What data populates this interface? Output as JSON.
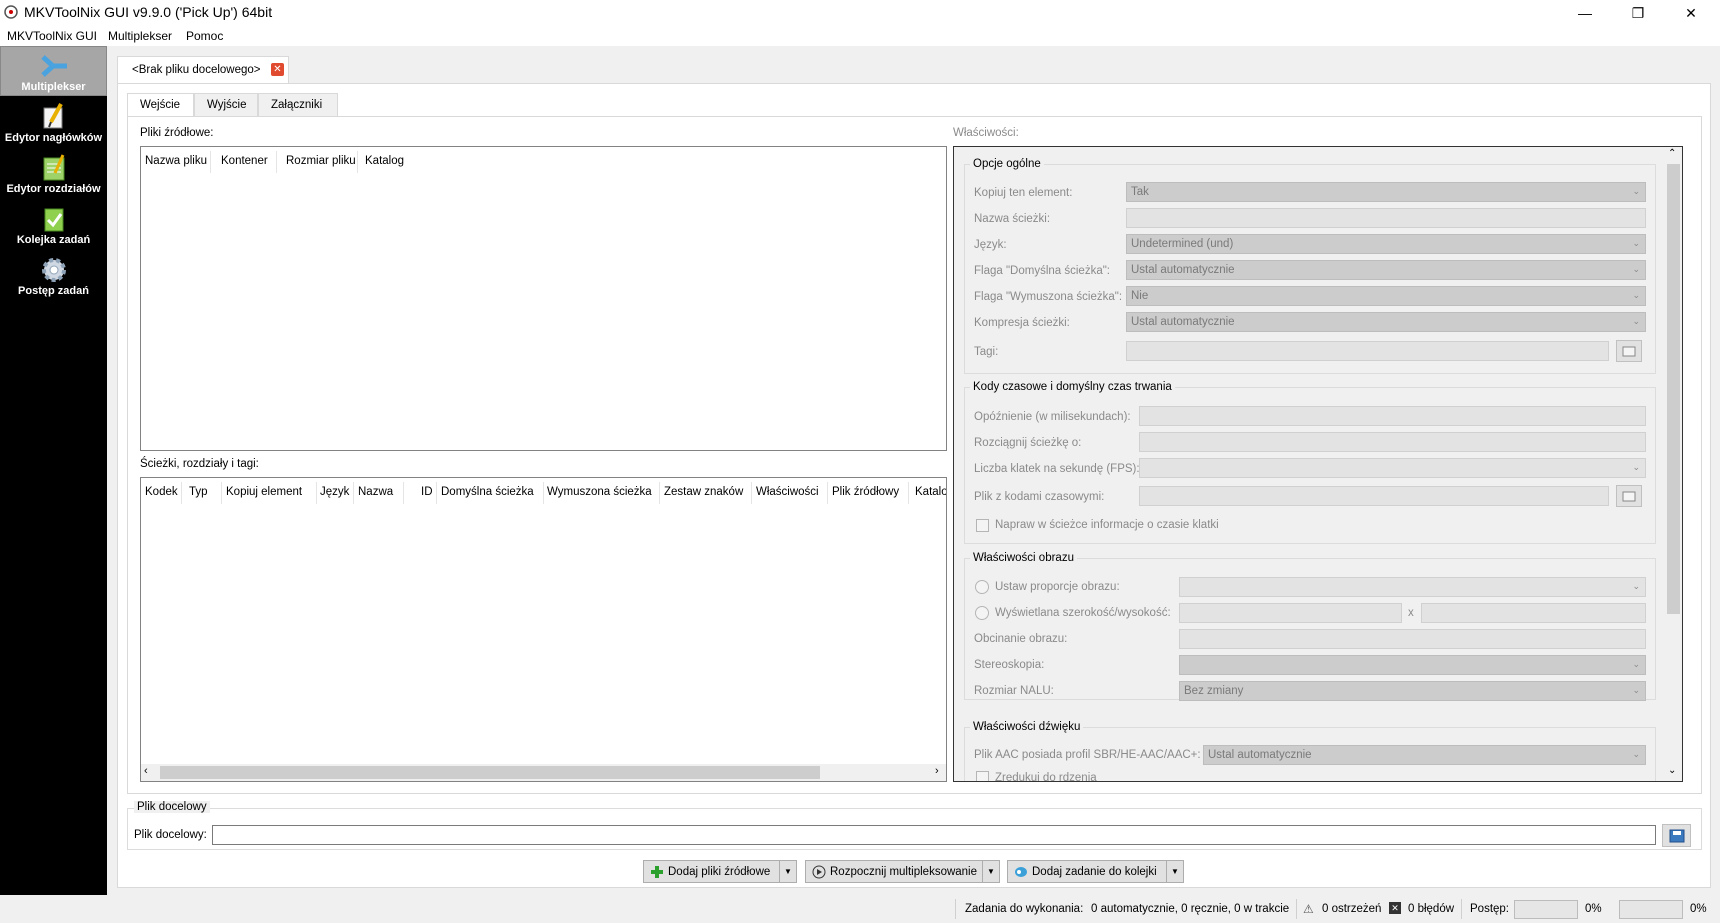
{
  "window": {
    "title": "MKVToolNix GUI v9.9.0 ('Pick Up') 64bit",
    "minimize": "—",
    "maximize": "❐",
    "close": "✕"
  },
  "menu": [
    "MKVToolNix GUI",
    "Multiplekser",
    "Pomoc"
  ],
  "sidebar": [
    {
      "label": "Multiplekser",
      "icon": "multiplexer-icon"
    },
    {
      "label": "Edytor nagłówków",
      "icon": "header-editor-icon"
    },
    {
      "label": "Edytor rozdziałów",
      "icon": "chapter-editor-icon"
    },
    {
      "label": "Kolejka zadań",
      "icon": "job-queue-icon"
    },
    {
      "label": "Postęp zadań",
      "icon": "job-progress-icon"
    }
  ],
  "doc_tab": {
    "label": "<Brak pliku docelowego>"
  },
  "subtabs": [
    "Wejście",
    "Wyjście",
    "Załączniki"
  ],
  "source_files": {
    "label": "Pliki źródłowe:",
    "columns": [
      "Nazwa pliku",
      "Kontener",
      "Rozmiar pliku",
      "Katalog"
    ]
  },
  "tracks": {
    "label": "Ścieżki, rozdziały i tagi:",
    "columns": [
      "Kodek",
      "Typ",
      "Kopiuj element",
      "Język",
      "Nazwa",
      "ID",
      "Domyślna ścieżka",
      "Wymuszona ścieżka",
      "Zestaw znaków",
      "Właściwości",
      "Plik źródłowy",
      "Katalo"
    ]
  },
  "properties": {
    "label": "Właściwości:",
    "general": {
      "title": "Opcje ogólne",
      "rows": [
        {
          "label": "Kopiuj ten element:",
          "value": "Tak"
        },
        {
          "label": "Nazwa ścieżki:",
          "value": ""
        },
        {
          "label": "Język:",
          "value": "Undetermined (und)"
        },
        {
          "label": "Flaga \"Domyślna ścieżka\":",
          "value": "Ustal automatycznie"
        },
        {
          "label": "Flaga \"Wymuszona ścieżka\":",
          "value": "Nie"
        },
        {
          "label": "Kompresja ścieżki:",
          "value": "Ustal automatycznie"
        },
        {
          "label": "Tagi:",
          "value": ""
        }
      ]
    },
    "timing": {
      "title": "Kody czasowe i domyślny czas trwania",
      "rows": [
        {
          "label": "Opóźnienie (w milisekundach):",
          "value": ""
        },
        {
          "label": "Rozciągnij ścieżkę o:",
          "value": ""
        },
        {
          "label": "Liczba klatek na sekundę (FPS):",
          "value": ""
        },
        {
          "label": "Plik z kodami czasowymi:",
          "value": ""
        }
      ],
      "checkbox": "Napraw w ścieżce informacje o czasie klatki"
    },
    "video": {
      "title": "Właściwości obrazu",
      "aspect": "Ustaw proporcje obrazu:",
      "display": "Wyświetlana szerokość/wysokość:",
      "x": "x",
      "crop": "Obcinanie obrazu:",
      "stereo": "Stereoskopia:",
      "nalu": "Rozmiar NALU:",
      "nalu_value": "Bez zmiany"
    },
    "audio": {
      "title": "Właściwości dźwięku",
      "aac": "Plik AAC posiada profil SBR/HE-AAC/AAC+:",
      "aac_value": "Ustal automatycznie",
      "reduce": "Zredukuj do rdzenia"
    }
  },
  "target": {
    "group": "Plik docelowy",
    "label": "Plik docelowy:",
    "value": ""
  },
  "actions": {
    "add": "Dodaj pliki źródłowe",
    "start": "Rozpocznij multipleksowanie",
    "queue": "Dodaj zadanie do kolejki"
  },
  "status": {
    "jobs": "Zadania do wykonania:",
    "counts": "0 automatycznie, 0 ręcznie, 0 w trakcie",
    "warnings": "0 ostrzeżeń",
    "errors": "0 błędów",
    "progress": "Postęp:",
    "pct1": "0%",
    "pct2": "0%"
  },
  "colors": {
    "sidebar": "#000000",
    "active_sidebar": "#a6a6a6",
    "close_tab": "#e04a2f"
  }
}
